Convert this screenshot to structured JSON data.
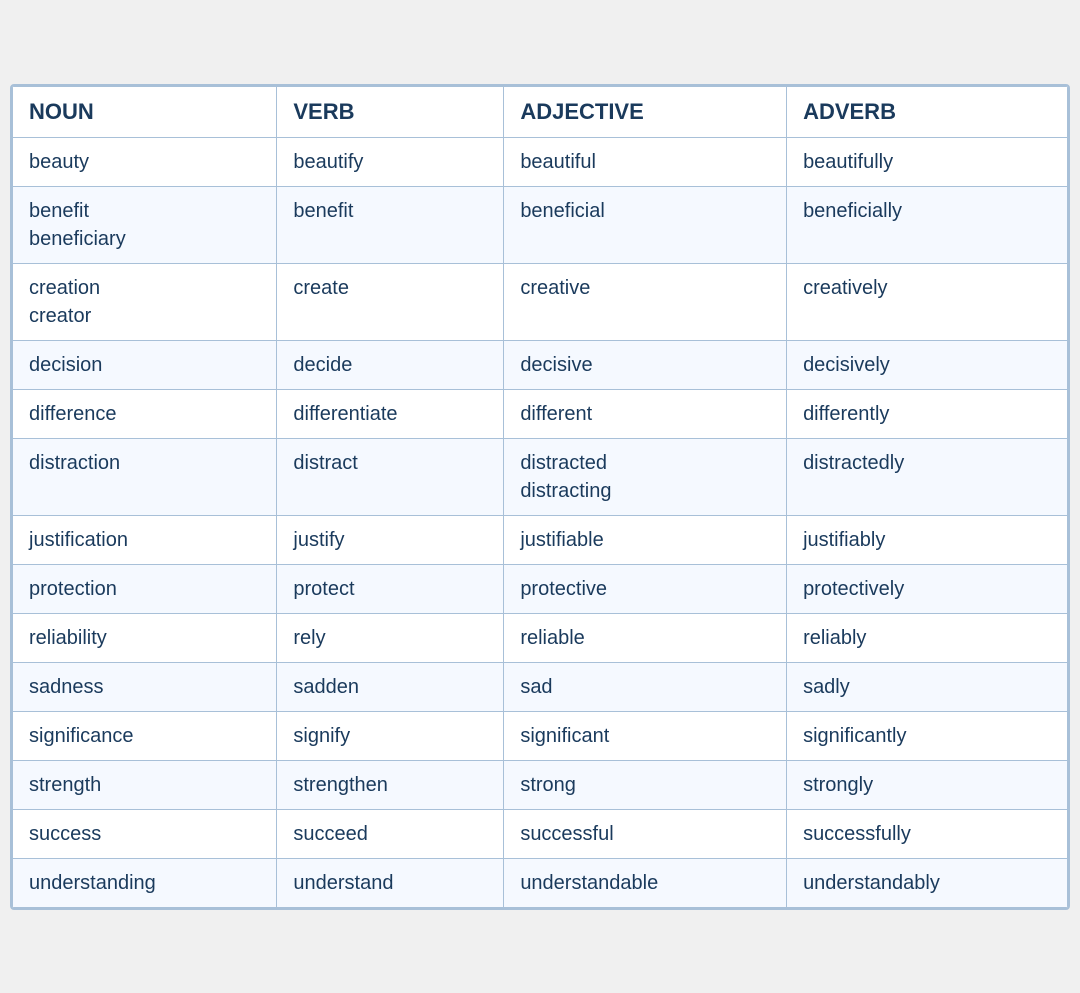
{
  "table": {
    "headers": [
      "NOUN",
      "VERB",
      "ADJECTIVE",
      "ADVERB"
    ],
    "rows": [
      {
        "noun": "beauty",
        "verb": "beautify",
        "adjective": "beautiful",
        "adverb": "beautifully"
      },
      {
        "noun": "benefit\nbeneficiary",
        "verb": "benefit",
        "adjective": "beneficial",
        "adverb": "beneficially"
      },
      {
        "noun": "creation\ncreator",
        "verb": "create",
        "adjective": "creative",
        "adverb": "creatively"
      },
      {
        "noun": "decision",
        "verb": "decide",
        "adjective": "decisive",
        "adverb": "decisively"
      },
      {
        "noun": "difference",
        "verb": "differentiate",
        "adjective": "different",
        "adverb": "differently"
      },
      {
        "noun": "distraction",
        "verb": "distract",
        "adjective": "distracted\ndistracting",
        "adverb": "distractedly"
      },
      {
        "noun": "justification",
        "verb": "justify",
        "adjective": "justifiable",
        "adverb": "justifiably"
      },
      {
        "noun": "protection",
        "verb": "protect",
        "adjective": "protective",
        "adverb": "protectively"
      },
      {
        "noun": "reliability",
        "verb": "rely",
        "adjective": "reliable",
        "adverb": "reliably"
      },
      {
        "noun": "sadness",
        "verb": "sadden",
        "adjective": "sad",
        "adverb": "sadly"
      },
      {
        "noun": "significance",
        "verb": "signify",
        "adjective": "significant",
        "adverb": "significantly"
      },
      {
        "noun": "strength",
        "verb": "strengthen",
        "adjective": "strong",
        "adverb": "strongly"
      },
      {
        "noun": "success",
        "verb": "succeed",
        "adjective": "successful",
        "adverb": "successfully"
      },
      {
        "noun": "understanding",
        "verb": "understand",
        "adjective": "understandable",
        "adverb": "understandably"
      }
    ]
  }
}
